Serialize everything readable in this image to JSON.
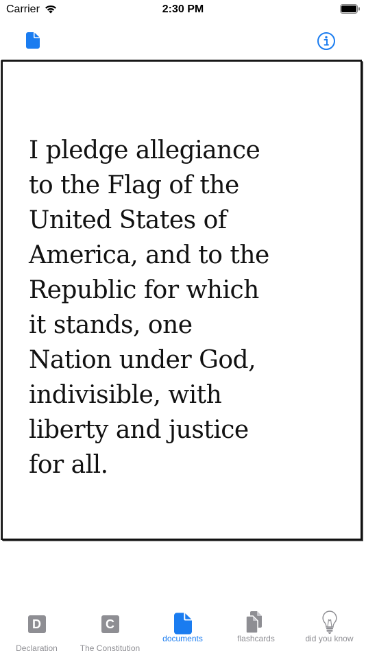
{
  "status_bar": {
    "carrier": "Carrier",
    "time": "2:30 PM"
  },
  "nav": {
    "left_icon": "document-icon",
    "right_icon": "info-icon"
  },
  "card": {
    "text": "I pledge allegiance to the Flag of the United States of America, and to the Republic for which it stands, one Nation under God, indivisible, with liberty and justice for all.",
    "lines": [
      "I pledge allegiance",
      "to the Flag of the",
      "United States of",
      "America, and to the",
      "Republic for which",
      "it stands, one",
      "Nation under God,",
      "indivisible, with",
      "liberty and justice",
      "for all."
    ]
  },
  "tabs": [
    {
      "label": "Declaration",
      "letter": "D",
      "icon": "letter-d-icon",
      "active": false
    },
    {
      "label": "The Constitution",
      "letter": "C",
      "icon": "letter-c-icon",
      "active": false
    },
    {
      "label": "documents",
      "icon": "document-icon",
      "active": true
    },
    {
      "label": "flashcards",
      "icon": "flashcards-icon",
      "active": false
    },
    {
      "label": "did you know",
      "icon": "lightbulb-icon",
      "active": false
    }
  ],
  "colors": {
    "accent": "#1a7cf0",
    "inactive": "#8e8e93"
  }
}
